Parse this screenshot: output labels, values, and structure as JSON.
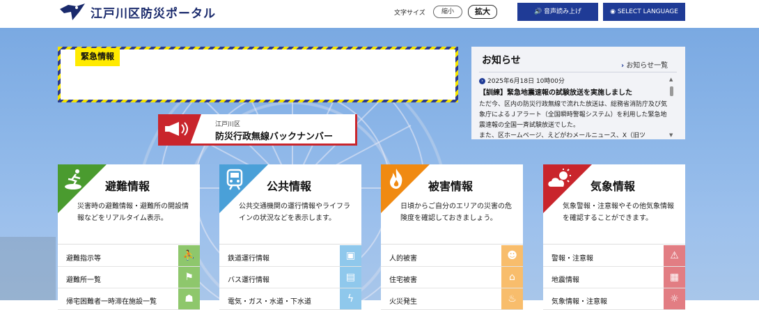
{
  "header": {
    "site_title": "江戸川区防災ポータル",
    "font_size_label": "文字サイズ",
    "font_small": "縮小",
    "font_large": "拡大",
    "voice_button": "音声読み上げ",
    "language_button": "SELECT LANGUAGE"
  },
  "emergency": {
    "label": "緊急情報"
  },
  "news": {
    "title": "お知らせ",
    "more_link": "お知らせ一覧",
    "date": "2025年6月18日 10時00分",
    "headline": "【訓練】緊急地震速報の試験放送を実施しました",
    "body": "ただ今、区内の防災行政無線で流れた放送は、総務省消防庁及び気象庁によるＪアラート（全国瞬時警報システム）を利用した緊急地震速報の全国一斉試験放送でした。",
    "body_cut": "また、区ホームページ、えどがわメールニュース、X（旧ツ"
  },
  "backnumber": {
    "sub": "江戸川区",
    "main": "防災行政無線バックナンバー"
  },
  "cards": [
    {
      "title": "避難情報",
      "desc": "災害時の避難情報・避難所の開設情報などをリアルタイム表示。",
      "color": "#4a9b2f",
      "light": "#8ec76c",
      "icon": "running-person-icon",
      "rows": [
        "避難指示等",
        "避難所一覧",
        "帰宅困難者一時滞在施設一覧"
      ]
    },
    {
      "title": "公共情報",
      "desc": "公共交通機関の運行情報やライフラインの状況などを表示します。",
      "color": "#4aa0d8",
      "light": "#8fc8ec",
      "icon": "train-icon",
      "rows": [
        "鉄道運行情報",
        "バス運行情報",
        "電気・ガス・水道・下水道"
      ]
    },
    {
      "title": "被害情報",
      "desc": "日頃からご自分のエリアの災害の危険度を確認しておきましょう。",
      "color": "#f08a12",
      "light": "#f8bd6c",
      "icon": "fire-icon",
      "rows": [
        "人的被害",
        "住宅被害",
        "火災発生"
      ]
    },
    {
      "title": "気象情報",
      "desc": "気象警報・注意報やその他気象情報を確認することができます。",
      "color": "#c9252c",
      "light": "#e27d83",
      "icon": "weather-icon",
      "rows": [
        "警報・注意報",
        "地震情報",
        "気象情報・注意報"
      ]
    }
  ]
}
